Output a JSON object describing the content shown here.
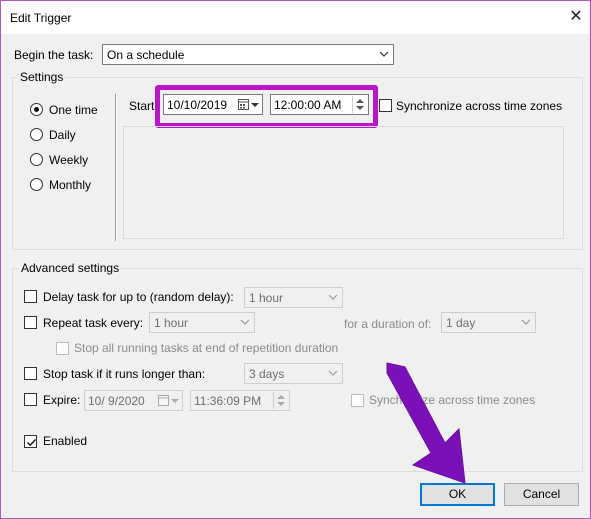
{
  "window": {
    "title": "Edit Trigger"
  },
  "begin": {
    "label": "Begin the task:",
    "value": "On a schedule"
  },
  "settings": {
    "legend": "Settings",
    "radios": [
      {
        "label": "One time",
        "selected": true
      },
      {
        "label": "Daily",
        "selected": false
      },
      {
        "label": "Weekly",
        "selected": false
      },
      {
        "label": "Monthly",
        "selected": false
      }
    ],
    "start_label": "Start:",
    "start_date": "10/10/2019",
    "start_time": "12:00:00 AM",
    "sync_label": "Synchronize across time zones"
  },
  "advanced": {
    "legend": "Advanced settings",
    "delay_label": "Delay task for up to (random delay):",
    "delay_value": "1 hour",
    "repeat_label": "Repeat task every:",
    "repeat_value": "1 hour",
    "duration_label": "for a duration of:",
    "duration_value": "1 day",
    "stop_running_label": "Stop all running tasks at end of repetition duration",
    "stop_longer_label": "Stop task if it runs longer than:",
    "stop_longer_value": "3 days",
    "expire_label": "Expire:",
    "expire_date": "10/  9/2020",
    "expire_time": "11:36:09 PM",
    "expire_sync_label": "Synchronize across time zones",
    "enabled_label": "Enabled",
    "enabled": true
  },
  "buttons": {
    "ok": "OK",
    "cancel": "Cancel"
  },
  "colors": {
    "highlight": "#b816c8",
    "arrow": "#7b10b8",
    "window_border": "#b452c9"
  }
}
